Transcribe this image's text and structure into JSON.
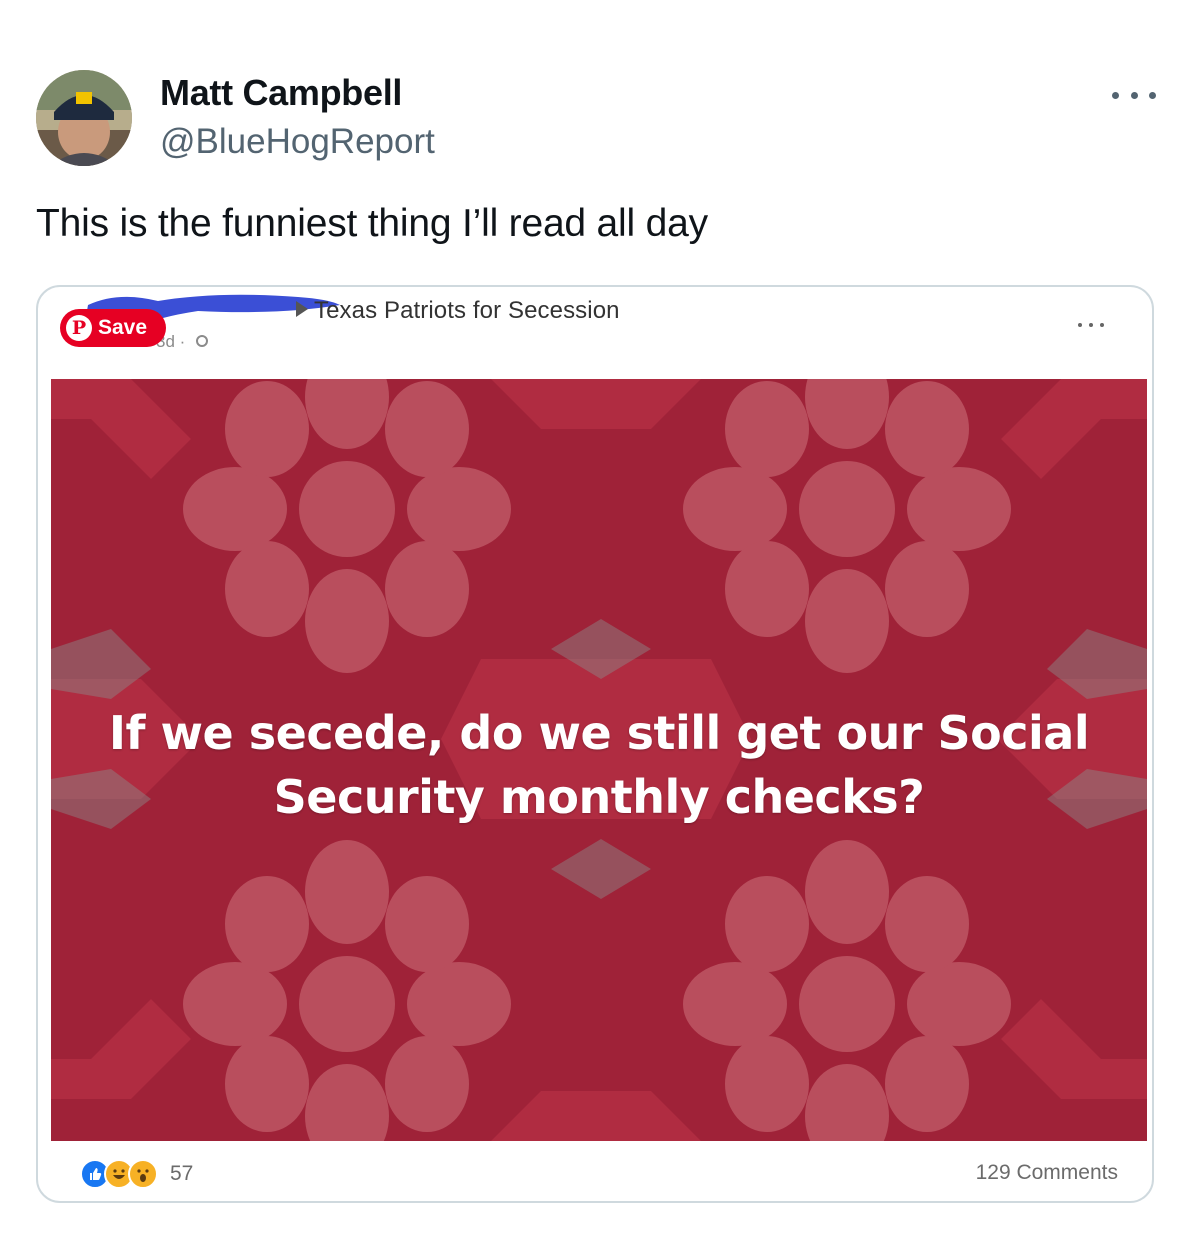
{
  "author": {
    "name": "Matt Campbell",
    "handle": "@BlueHogReport"
  },
  "tweet": {
    "text": "This is the funniest thing I’ll read all day"
  },
  "embedded_post": {
    "group_name": "Texas Patriots for Secession",
    "time": "3d ·",
    "pinterest_save_label": "Save",
    "image_text_line1": "If we secede, do we still get our Social",
    "image_text_line2": "Security monthly checks?",
    "reaction_count": "57",
    "comments": "129 Comments",
    "background_color": "#9f2238"
  }
}
